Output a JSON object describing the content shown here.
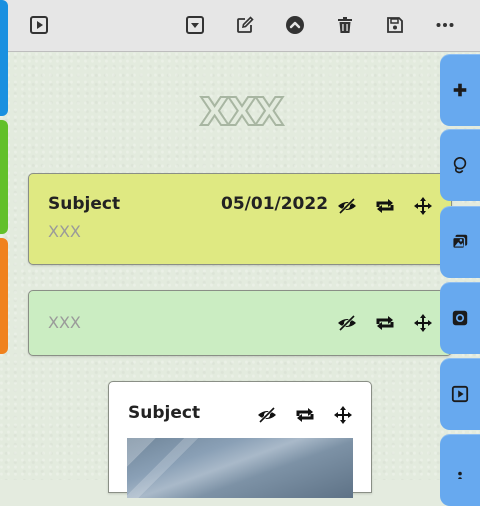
{
  "toolbar": {
    "buttons": [
      {
        "name": "play-button",
        "icon": "play-square-icon"
      },
      {
        "name": "dropdown-button",
        "icon": "caret-down-square-icon"
      },
      {
        "name": "edit-button",
        "icon": "pencil-square-icon"
      },
      {
        "name": "collapse-button",
        "icon": "chevron-up-circle-icon"
      },
      {
        "name": "delete-button",
        "icon": "trash-icon"
      },
      {
        "name": "save-button",
        "icon": "floppy-disk-icon"
      },
      {
        "name": "more-button",
        "icon": "ellipsis-icon"
      }
    ]
  },
  "watermark": {
    "text": "XXX"
  },
  "cards": [
    {
      "subject": "Subject",
      "date": "05/01/2022",
      "body": "XXX",
      "color": "#dfe982"
    },
    {
      "subject": "",
      "date": "",
      "body": "XXX",
      "color": "#cbedc2"
    },
    {
      "subject": "Subject",
      "date": "",
      "body": "",
      "color": "#ffffff"
    }
  ],
  "right_rail": {
    "tabs": [
      "add-icon",
      "lasso-icon",
      "photo-album-icon",
      "camera-icon",
      "play-icon",
      "more-vertical-icon"
    ],
    "color": "#67a9ef"
  },
  "left_tabs": [
    {
      "color": "#1a90e0"
    },
    {
      "color": "#62c02a"
    },
    {
      "color": "#f0821e"
    }
  ]
}
